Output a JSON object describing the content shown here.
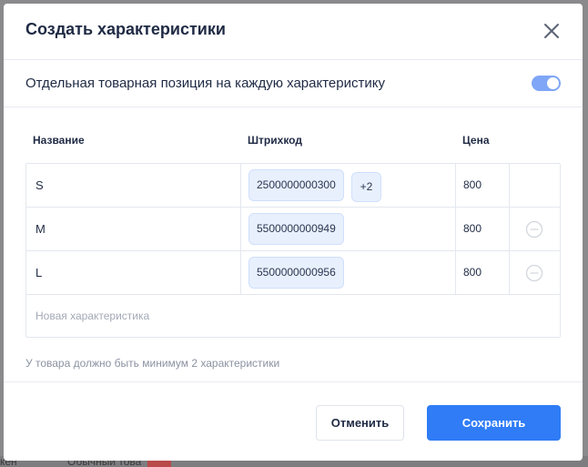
{
  "backdrop": {
    "left_text": "кен",
    "row_text": "Обычный това"
  },
  "modal": {
    "title": "Создать характеристики",
    "toggle_label": "Отдельная товарная позиция на каждую характеристику",
    "toggle_on": true,
    "columns": {
      "name": "Название",
      "barcode": "Штрихкод",
      "price": "Цена"
    },
    "rows": [
      {
        "name": "S",
        "barcode": "2500000000300",
        "more": "+2",
        "price": "800",
        "removable": false
      },
      {
        "name": "M",
        "barcode": "5500000000949",
        "more": "",
        "price": "800",
        "removable": true
      },
      {
        "name": "L",
        "barcode": "5500000000956",
        "more": "",
        "price": "800",
        "removable": true
      }
    ],
    "new_row_placeholder": "Новая характеристика",
    "hint": "У товара должно быть минимум 2 характеристики",
    "cancel_label": "Отменить",
    "save_label": "Сохранить"
  },
  "colors": {
    "accent": "#2f7cf6",
    "toggle": "#7fa6f7",
    "chip_bg": "#e8f0fe"
  }
}
